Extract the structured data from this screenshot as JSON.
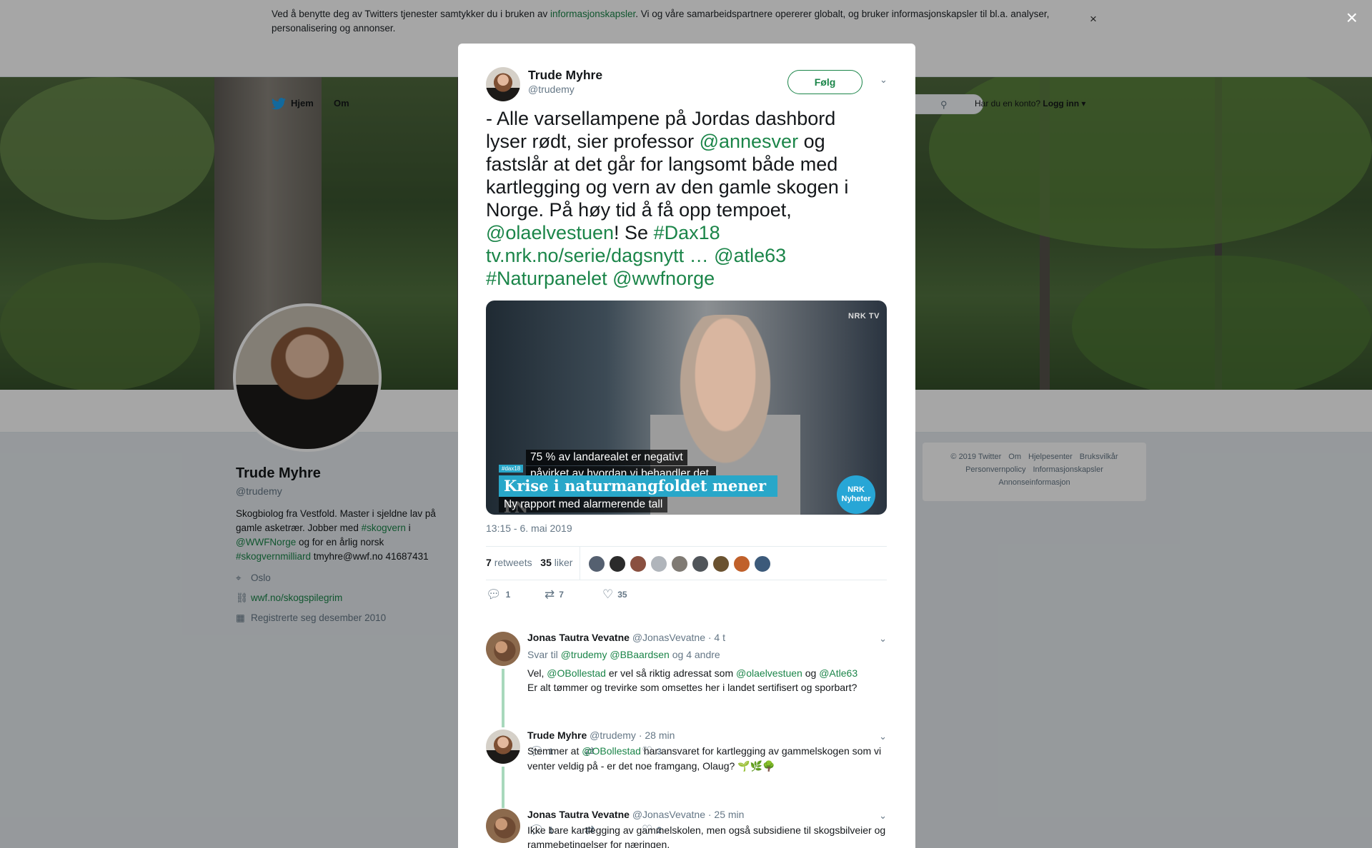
{
  "cookie": {
    "text_before": "Ved å benytte deg av Twitters tjenester samtykker du i bruken av ",
    "link": "informasjonskapsler",
    "text_after": ". Vi og våre samarbeidspartnere opererer globalt, og bruker informasjonskapsler til bl.a. analyser, personalisering og annonser.",
    "close": "×"
  },
  "nav": {
    "home": "Hjem",
    "about": "Om",
    "account_question": "Har du en konto?",
    "login": "Logg inn"
  },
  "profile": {
    "name": "Trude Myhre",
    "handle": "@trudemy",
    "bio": {
      "t1": "Skogbiolog fra Vestfold. Master i sjeldne lav på gamle asketrær. Jobber med ",
      "l1": "#skogvern",
      "t2": " i ",
      "l2": "@WWFNorge",
      "t3": " og for en årlig norsk ",
      "l3": "#skogvernmilliard",
      "t4": " tmyhre@wwf.no 41687431"
    },
    "location": "Oslo",
    "website": "wwf.no/skogspilegrim",
    "joined": "Registrerte seg desember 2010"
  },
  "footer": {
    "items": [
      "© 2019 Twitter",
      "Om",
      "Hjelpesenter",
      "Bruksvilkår",
      "Personvernpolicy",
      "Informasjonskapsler",
      "Annonseinformasjon"
    ]
  },
  "overlay_close": "×",
  "tweet": {
    "author_name": "Trude Myhre",
    "author_handle": "@trudemy",
    "follow": "Følg",
    "text": {
      "t1": "- Alle varsellampene på Jordas dashbord lyser rødt, sier professor ",
      "m1": "@annesver",
      "t2": " og fastslår at det går for langsomt både med kartlegging og vern av den gamle skogen i Norge. På høy tid å få opp tempoet, ",
      "m2": "@olaelvestuen",
      "t3": "! Se ",
      "h1": "#Dax18",
      "u1": "tv.nrk.no/serie/dagsnytt …",
      "m3": "@atle63",
      "h2": "#Naturpanelet",
      "m4": "@wwfnorge"
    },
    "media": {
      "logo": "NRK TV",
      "caption1": "75 % av landarealet er negativt",
      "caption2": "påvirket av hvordan vi behandler det.",
      "tag": "#dax18",
      "headline": "Krise i naturmangfoldet mener FN",
      "subline": "Ny rapport med alarmerende tall",
      "badge1": "NRK",
      "badge2": "Nyheter"
    },
    "timestamp": "13:15 - 6. mai 2019",
    "retweets": "7",
    "retweets_label": "retweets",
    "likes": "35",
    "likes_label": "liker",
    "actions": {
      "reply": "1",
      "retweet": "7",
      "like": "35"
    }
  },
  "replies": [
    {
      "name": "Jonas Tautra Vevatne",
      "handle": "@JonasVevatne",
      "time": "· 4 t",
      "reply_prefix": "Svar til ",
      "reply_users": "@trudemy @BBaardsen",
      "reply_suffix": " og 4 andre",
      "t1": "Vel, ",
      "m1": "@OBollestad",
      "t2": " er vel så riktig adressat som ",
      "m2": "@olaelvestuen",
      "t3": " og ",
      "m3": "@Atle63",
      "line2": "Er alt tømmer og trevirke som omsettes her i landet sertifisert og sporbart?",
      "reply_count": "1",
      "retweet_count": "",
      "like_count": "3"
    },
    {
      "name": "Trude Myhre",
      "handle": "@trudemy",
      "time": "· 28 min",
      "t1": "Stemmer at ",
      "m1": "@OBollestad",
      "t2": " har ansvaret for kartlegging av gammelskogen som vi venter veldig på - er det noe framgang, Olaug? 🌱🌿🌳",
      "reply_count": "1",
      "retweet_count": "",
      "like_count": "2"
    },
    {
      "name": "Jonas Tautra Vevatne",
      "handle": "@JonasVevatne",
      "time": "· 25 min",
      "t1": "Ikke bare kartlegging av gammelskolen, men også subsidiene til skogsbilveier og rammebetingelser for næringen."
    }
  ],
  "colors": {
    "accent": "#1b8549",
    "muted": "#657786",
    "nrk_blue": "#28a7c9"
  }
}
